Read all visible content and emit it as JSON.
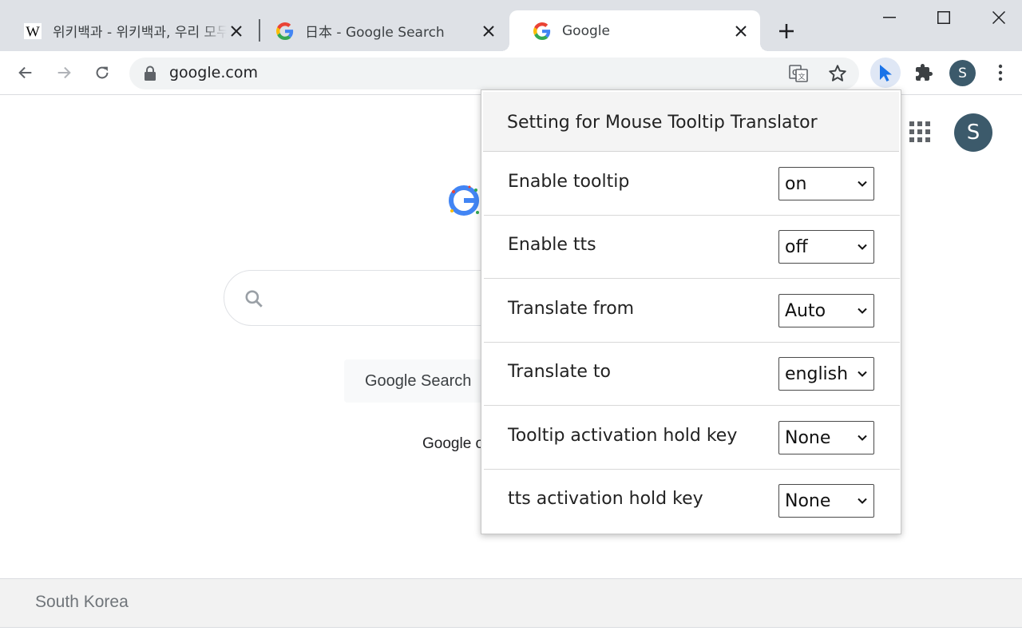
{
  "tabs": [
    {
      "title": "위키백과 - 위키백과, 우리 모두",
      "favicon": "wikipedia-icon",
      "active": false
    },
    {
      "title": "日本 - Google Search",
      "favicon": "google-icon",
      "active": false
    },
    {
      "title": "Google",
      "favicon": "google-icon",
      "active": true
    }
  ],
  "toolbar": {
    "url": "google.com",
    "avatar_initial": "S",
    "colors": {
      "active_extension": "#1a73e8",
      "avatar": "#3c5a6b"
    }
  },
  "page": {
    "search_button": "Google Search",
    "offered_in": "Google offered in:",
    "footer_country": "South Korea",
    "avatar_initial": "S"
  },
  "popup": {
    "title": "Setting for Mouse Tooltip Translator",
    "settings": [
      {
        "label": "Enable tooltip",
        "value": "on"
      },
      {
        "label": "Enable tts",
        "value": "off"
      },
      {
        "label": "Translate from",
        "value": "Auto"
      },
      {
        "label": "Translate to",
        "value": "english"
      },
      {
        "label": "Tooltip activation hold key",
        "value": "None"
      },
      {
        "label": "tts activation hold key",
        "value": "None"
      }
    ]
  }
}
